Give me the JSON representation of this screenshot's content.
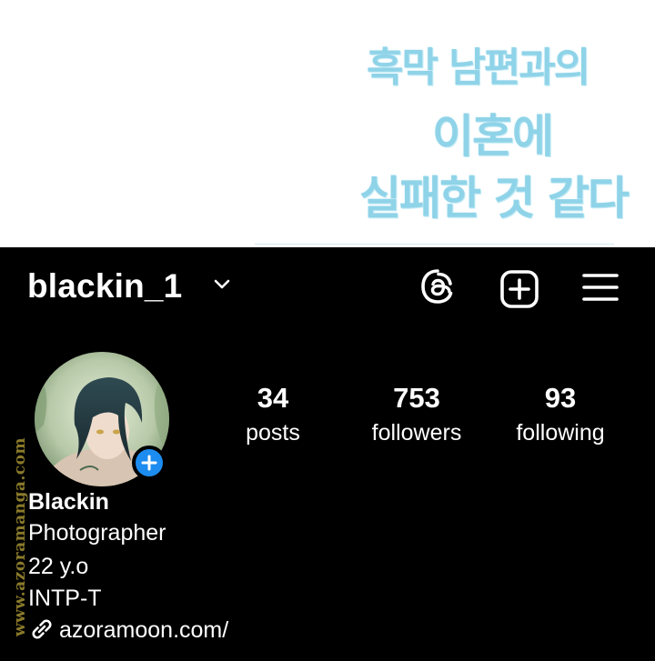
{
  "banner": {
    "title_line1": "흑막 남편과의",
    "title_line2": "이혼에",
    "title_line3": "실패한 것 같다",
    "title_color": "#8fd3e8"
  },
  "header": {
    "username": "blackin_1",
    "icons": [
      "chevron-down-icon",
      "threads-icon",
      "add-post-icon",
      "menu-icon"
    ]
  },
  "stats": {
    "posts_count": "34",
    "posts_label": "posts",
    "followers_count": "753",
    "followers_label": "followers",
    "following_count": "93",
    "following_label": "following"
  },
  "bio": {
    "name": "Blackin",
    "line1": "Photographer",
    "line2": "22 y.o",
    "line3": "INTP-T",
    "link": "azoramoon.com/"
  },
  "watermark": "www.azoramanga.com",
  "colors": {
    "panel_bg": "#000000",
    "text": "#ffffff",
    "badge_blue": "#1d8cf0"
  }
}
